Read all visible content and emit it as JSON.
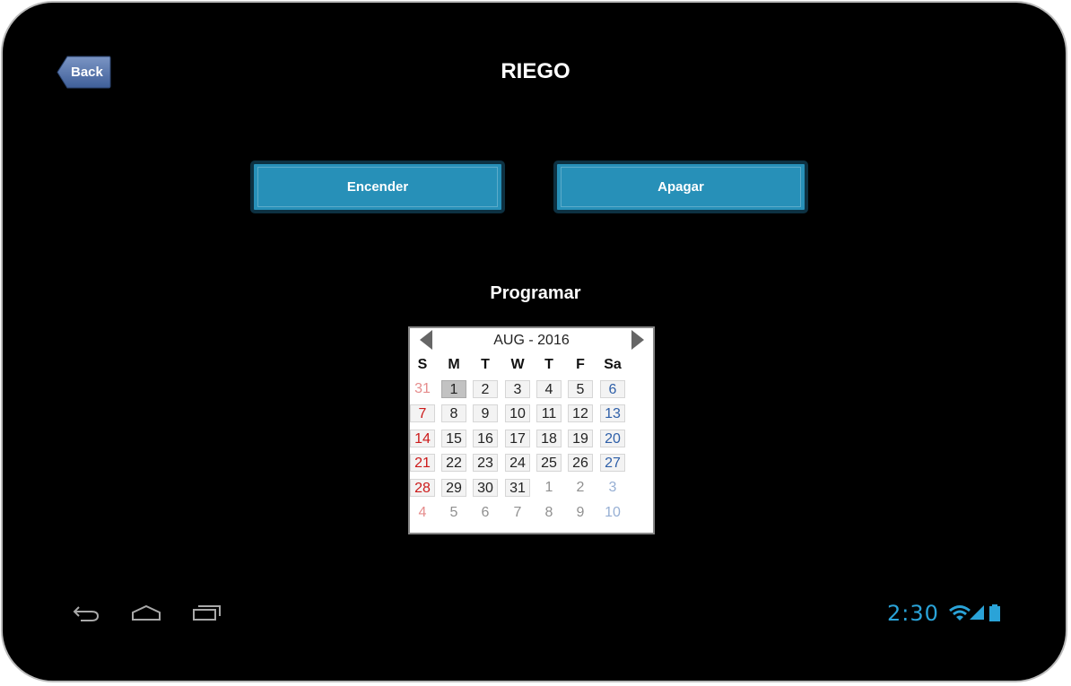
{
  "header": {
    "back_label": "Back",
    "title": "RIEGO"
  },
  "actions": {
    "on_label": "Encender",
    "off_label": "Apagar"
  },
  "schedule": {
    "heading": "Programar"
  },
  "calendar": {
    "month_year": "AUG - 2016",
    "weekdays": [
      "S",
      "M",
      "T",
      "W",
      "T",
      "F",
      "Sa"
    ],
    "weeks": [
      [
        "31",
        "1",
        "2",
        "3",
        "4",
        "5",
        "6"
      ],
      [
        "7",
        "8",
        "9",
        "10",
        "11",
        "12",
        "13"
      ],
      [
        "14",
        "15",
        "16",
        "17",
        "18",
        "19",
        "20"
      ],
      [
        "21",
        "22",
        "23",
        "24",
        "25",
        "26",
        "27"
      ],
      [
        "28",
        "29",
        "30",
        "31",
        "1",
        "2",
        "3"
      ],
      [
        "4",
        "5",
        "6",
        "7",
        "8",
        "9",
        "10"
      ]
    ],
    "selected_day": "1",
    "colors": {
      "sunday": "#cc1a1a",
      "saturday": "#2e5fa8",
      "weekday": "#222222"
    }
  },
  "status_bar": {
    "time": "2:30",
    "icons": [
      "back-nav-icon",
      "home-nav-icon",
      "recent-apps-icon",
      "wifi-icon",
      "signal-icon",
      "battery-icon"
    ],
    "accent": "#2aa3d8"
  }
}
